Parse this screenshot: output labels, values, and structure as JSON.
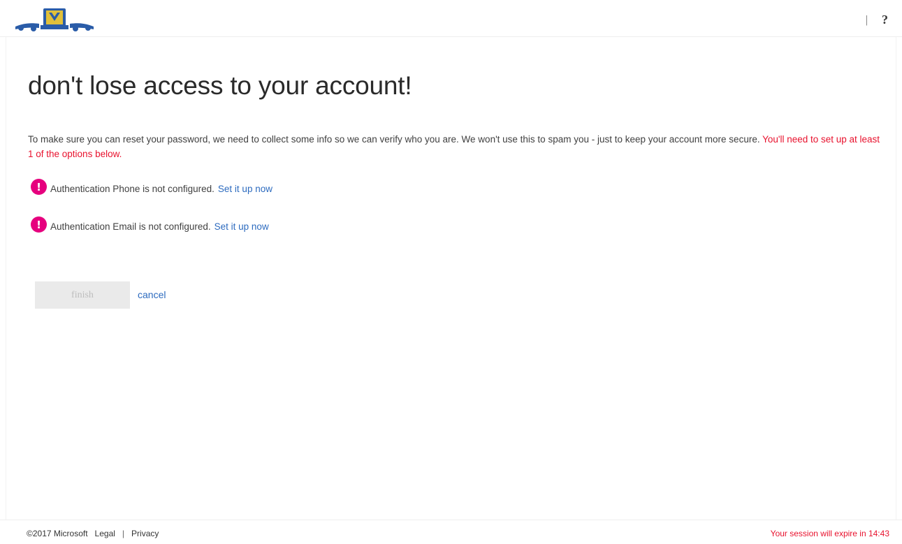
{
  "header": {
    "logo_name": "crest-logo",
    "divider": "|",
    "help_label": "?"
  },
  "main": {
    "title": "don't lose access to your account!",
    "intro_text": "To make sure you can reset your password, we need to collect some info so we can verify who you are. We won't use this to spam you - just to keep your account more secure.",
    "intro_required": "You'll need to set up at least 1 of the options below.",
    "items": [
      {
        "icon": "exclamation-icon",
        "text": "Authentication Phone is not configured.",
        "link": "Set it up now"
      },
      {
        "icon": "exclamation-icon",
        "text": "Authentication Email is not configured.",
        "link": "Set it up now"
      }
    ],
    "finish_label": "finish",
    "cancel_label": "cancel"
  },
  "footer": {
    "copyright": "©2017 Microsoft",
    "legal": "Legal",
    "separator": "|",
    "privacy": "Privacy",
    "session_notice": "Your session will expire in 14:43"
  },
  "colors": {
    "warning": "#e6007e",
    "required_text": "#e8112d",
    "link": "#2d6bbf",
    "logo_blue": "#2a5ca8",
    "logo_gold": "#e1c03a"
  }
}
